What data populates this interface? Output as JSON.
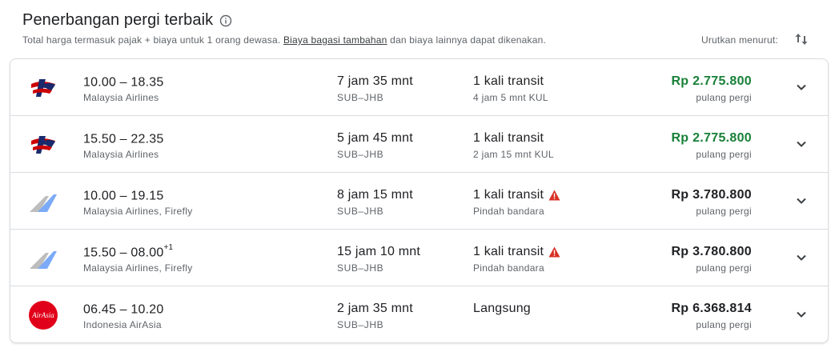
{
  "header": {
    "title": "Penerbangan pergi terbaik",
    "subtitle_before": "Total harga termasuk pajak + biaya untuk 1 orang dewasa. ",
    "subtitle_link": "Biaya bagasi tambahan",
    "subtitle_after": " dan biaya lainnya dapat dikenakan.",
    "sort_label": "Urutkan menurut:"
  },
  "colors": {
    "price_green": "#188038",
    "warning_red": "#d93025",
    "text_secondary": "#5f6368"
  },
  "flights": [
    {
      "logo": "malaysia-airlines-logo",
      "times": "10.00 – 18.35",
      "times_sup": "",
      "airline": "Malaysia Airlines",
      "duration": "7 jam 35 mnt",
      "route": "SUB–JHB",
      "stops": "1 kali transit",
      "stop_detail": "4 jam 5 mnt KUL",
      "warning": false,
      "price": "Rp 2.775.800",
      "price_green": true,
      "price_sub": "pulang pergi"
    },
    {
      "logo": "malaysia-airlines-logo",
      "times": "15.50 – 22.35",
      "times_sup": "",
      "airline": "Malaysia Airlines",
      "duration": "5 jam 45 mnt",
      "route": "SUB–JHB",
      "stops": "1 kali transit",
      "stop_detail": "2 jam 15 mnt KUL",
      "warning": false,
      "price": "Rp 2.775.800",
      "price_green": true,
      "price_sub": "pulang pergi"
    },
    {
      "logo": "multi-airline-tail-logo",
      "times": "10.00 – 19.15",
      "times_sup": "",
      "airline": "Malaysia Airlines, Firefly",
      "duration": "8 jam 15 mnt",
      "route": "SUB–JHB",
      "stops": "1 kali transit",
      "stop_detail": "Pindah bandara",
      "warning": true,
      "price": "Rp 3.780.800",
      "price_green": false,
      "price_sub": "pulang pergi"
    },
    {
      "logo": "multi-airline-tail-logo",
      "times": "15.50 – 08.00",
      "times_sup": "+1",
      "airline": "Malaysia Airlines, Firefly",
      "duration": "15 jam 10 mnt",
      "route": "SUB–JHB",
      "stops": "1 kali transit",
      "stop_detail": "Pindah bandara",
      "warning": true,
      "price": "Rp 3.780.800",
      "price_green": false,
      "price_sub": "pulang pergi"
    },
    {
      "logo": "airasia-logo",
      "times": "06.45 – 10.20",
      "times_sup": "",
      "airline": "Indonesia AirAsia",
      "duration": "2 jam 35 mnt",
      "route": "SUB–JHB",
      "stops": "Langsung",
      "stop_detail": "",
      "warning": false,
      "price": "Rp 6.368.814",
      "price_green": false,
      "price_sub": "pulang pergi",
      "logo_text": "AirAsia"
    }
  ]
}
